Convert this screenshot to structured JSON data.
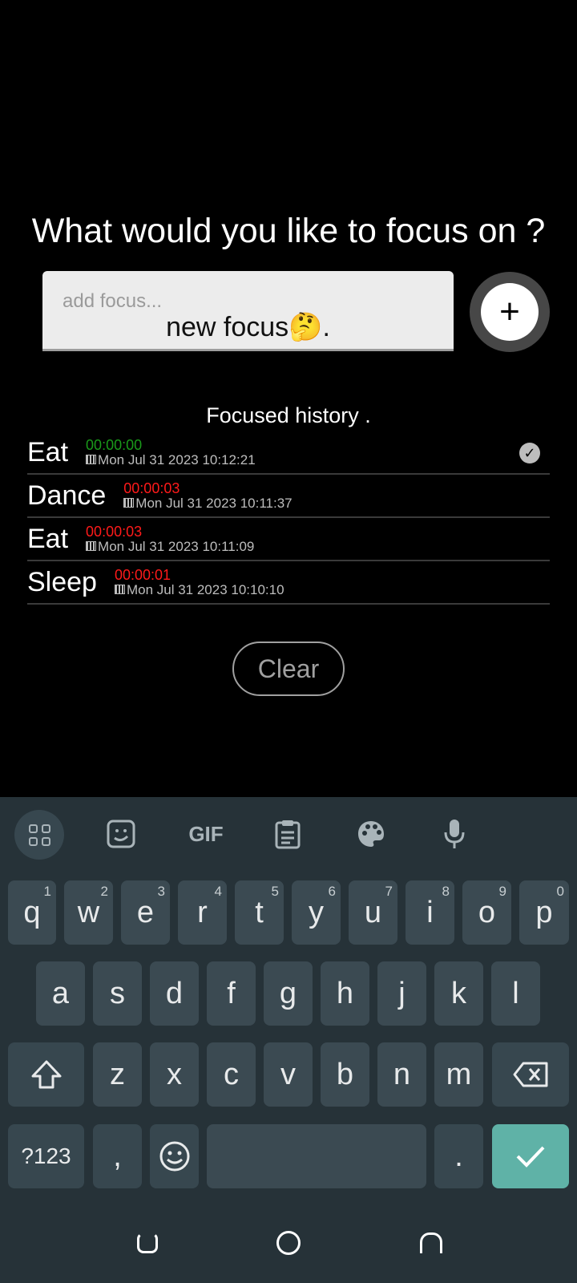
{
  "headline": "What would you like to focus on ?",
  "focus_input": {
    "placeholder": "add focus...",
    "value": "new focus🤔."
  },
  "add_button_label": "+",
  "history": {
    "title": "Focused history .",
    "items": [
      {
        "name": "Eat",
        "duration": "00:00:00",
        "duration_color": "#1a9a1a",
        "date": "Mon Jul 31 2023 10:12:21",
        "completed": true
      },
      {
        "name": "Dance",
        "duration": "00:00:03",
        "duration_color": "#ff1a1a",
        "date": "Mon Jul 31 2023 10:11:37",
        "completed": false
      },
      {
        "name": "Eat",
        "duration": "00:00:03",
        "duration_color": "#ff1a1a",
        "date": "Mon Jul 31 2023 10:11:09",
        "completed": false
      },
      {
        "name": "Sleep",
        "duration": "00:00:01",
        "duration_color": "#ff1a1a",
        "date": "Mon Jul 31 2023 10:10:10",
        "completed": false
      }
    ]
  },
  "clear_label": "Clear",
  "keyboard": {
    "toolbar": {
      "gif_label": "GIF",
      "icons": [
        "apps-grid-icon",
        "sticker-icon",
        "gif-icon",
        "clipboard-icon",
        "palette-icon",
        "mic-icon"
      ]
    },
    "row1": [
      {
        "key": "q",
        "hint": "1"
      },
      {
        "key": "w",
        "hint": "2"
      },
      {
        "key": "e",
        "hint": "3"
      },
      {
        "key": "r",
        "hint": "4"
      },
      {
        "key": "t",
        "hint": "5"
      },
      {
        "key": "y",
        "hint": "6"
      },
      {
        "key": "u",
        "hint": "7"
      },
      {
        "key": "i",
        "hint": "8"
      },
      {
        "key": "o",
        "hint": "9"
      },
      {
        "key": "p",
        "hint": "0"
      }
    ],
    "row2": [
      "a",
      "s",
      "d",
      "f",
      "g",
      "h",
      "j",
      "k",
      "l"
    ],
    "row3": [
      "z",
      "x",
      "c",
      "v",
      "b",
      "n",
      "m"
    ],
    "symbols_label": "?123",
    "comma_label": ",",
    "period_label": "."
  },
  "colors": {
    "background": "#000000",
    "keyboard_bg": "#263238",
    "key_bg": "#3b4a52",
    "enter_key": "#5fb2a7",
    "timer_zero": "#1a9a1a",
    "timer_elapsed": "#ff1a1a"
  }
}
